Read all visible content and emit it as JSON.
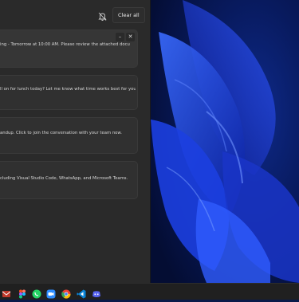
{
  "notification_center": {
    "clear_all_label": "Clear all",
    "dnd_icon": "bell-off-icon",
    "minimize_icon": "minimize-icon",
    "close_icon": "close-icon",
    "notifications": [
      {
        "text": "ing - Tomorrow at 10:00 AM. Please review the attached documents"
      },
      {
        "text": "ll on for lunch today? Let me know what time works best for you!"
      },
      {
        "text": "andup. Click to join the conversation with your team now."
      },
      {
        "text": "cluding Visual Studio Code, WhatsApp, and Microsoft Teams."
      }
    ]
  },
  "wallpaper": {
    "name": "windows-11-bloom"
  },
  "taskbar": {
    "icons": [
      "mail-icon",
      "figma-icon",
      "whatsapp-icon",
      "zoom-icon",
      "chrome-icon",
      "vscode-icon",
      "discord-icon"
    ]
  },
  "colors": {
    "panel_bg": "#2a2a2a",
    "card_bg": "#303030",
    "accent_blue": "#1a3ee8",
    "taskbar_bg": "#202020"
  }
}
